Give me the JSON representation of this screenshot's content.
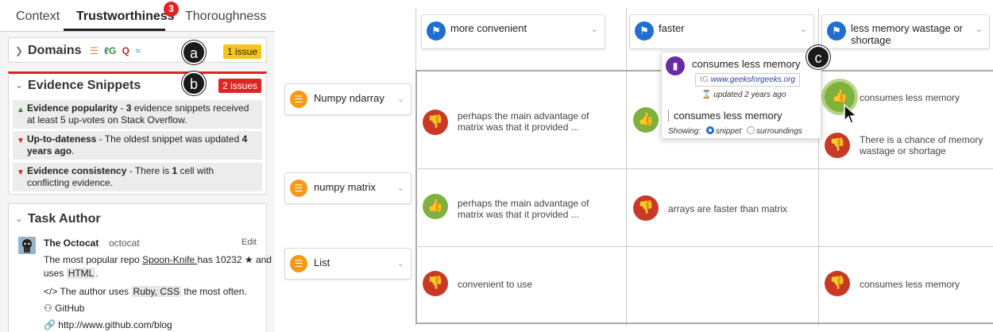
{
  "tabs": {
    "context": "Context",
    "trustworthiness": "Trustworthiness",
    "trustworthiness_badge": "3",
    "thoroughness": "Thoroughness"
  },
  "domains": {
    "title": "Domains",
    "issue": "1 issue",
    "callout": "a",
    "icons": [
      "stackoverflow-icon",
      "geeksforgeeks-icon",
      "quora-icon",
      "other-domain-icon"
    ]
  },
  "evidence": {
    "title": "Evidence Snippets",
    "issue": "2 issues",
    "callout": "b",
    "rows": [
      {
        "bold": "Evidence popularity",
        "text_a": " - ",
        "bold2": "3",
        "text_b": " evidence snippets received at least 5 up-votes on Stack Overflow.",
        "trend": "up"
      },
      {
        "bold": "Up-to-dateness",
        "text_a": " - The oldest snippet was updated ",
        "bold2": "4 years ago",
        "text_b": ".",
        "trend": "down"
      },
      {
        "bold": "Evidence consistency",
        "text_a": " - There is ",
        "bold2": "1",
        "text_b": " cell with conflicting evidence.",
        "trend": "down"
      }
    ]
  },
  "author": {
    "title": "Task Author",
    "name": "The Octocat",
    "handle": "octocat",
    "edit": "Edit",
    "repo_prefix": "The most popular repo ",
    "repo_name": "Spoon-Knife ",
    "repo_mid": "has 10232 ★ and",
    "uses_prefix": "uses ",
    "uses_lang": "HTML",
    "uses_suffix": ".",
    "code_prefix": "</> The author uses ",
    "code_langs": "Ruby, CSS",
    "code_suffix": " the most often.",
    "github": "GitHub",
    "blog": "http://www.github.com/blog"
  },
  "columns": [
    {
      "label": "more convenient"
    },
    {
      "label": "faster"
    },
    {
      "label": "less memory wastage or shortage"
    }
  ],
  "rows": [
    {
      "label": "Numpy ndarray"
    },
    {
      "label": "numpy matrix"
    },
    {
      "label": "List"
    }
  ],
  "cells": {
    "r1c1": "perhaps the main advantage of matrix was that it provided ...",
    "r1c3a": "consumes less memory",
    "r1c3b": "There is a chance of memory wastage or shortage",
    "r2c1": "perhaps the main advantage of matrix was that it provided ...",
    "r2c2": "arrays are faster than matrix",
    "r3c1": "convenient to use",
    "r3c3": "consumes less memory"
  },
  "popup": {
    "callout": "c",
    "title": "consumes less memory",
    "source": "www.geeksforgeeks.org",
    "updated": "updated 2 years ago",
    "snippet": "consumes less memory",
    "showing_label": "Showing:",
    "option_snippet": "snippet",
    "option_surroundings": "surroundings"
  },
  "colors": {
    "accent_blue": "#1f6fd1",
    "issue_red": "#e02424",
    "issue_yellow": "#f5c518",
    "thumb_down": "#c83a25",
    "thumb_up": "#7fb13d",
    "list_orange": "#f59a16"
  }
}
